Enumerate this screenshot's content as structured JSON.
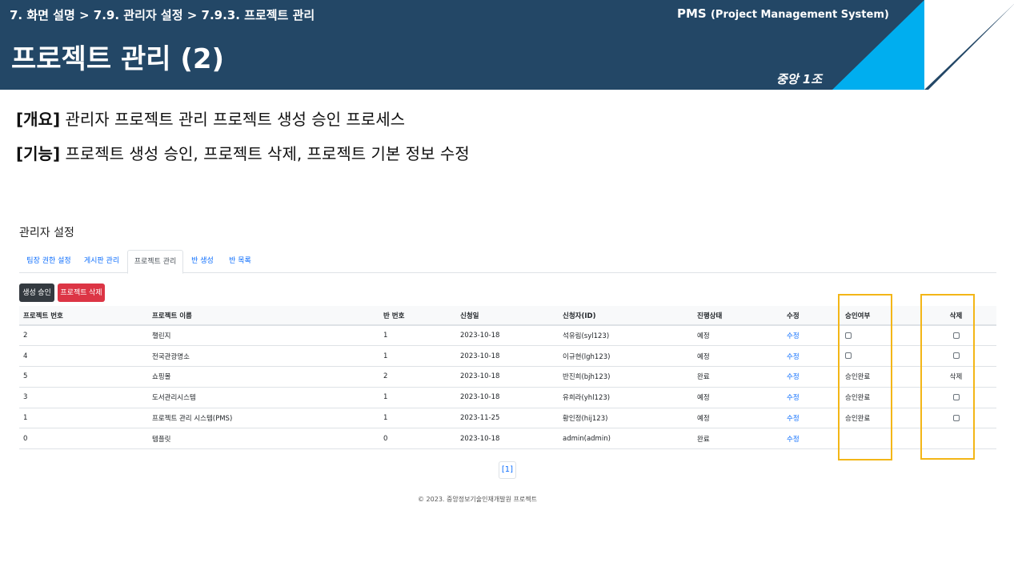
{
  "header": {
    "breadcrumb": "7. 화면 설명 > 7.9. 관리자 설정 > 7.9.3. 프로젝트 관리",
    "title": "프로젝트 관리 (2)",
    "system_name": "PMS",
    "system_full": "(Project Management System)",
    "team": "중앙 1조",
    "colors": {
      "navy": "#234766",
      "cyan": "#00aeef"
    }
  },
  "summary": {
    "overview_label": "[개요]",
    "overview_text": " 관리자 프로젝트 관리 프로젝트 생성 승인 프로세스",
    "feature_label": "[기능]",
    "feature_text": " 프로젝트 생성 승인, 프로젝트 삭제, 프로젝트 기본 정보 수정"
  },
  "app": {
    "title": "관리자 설정",
    "tabs": [
      "팀장 권한 설정",
      "게시판 관리",
      "프로젝트 관리",
      "반 생성",
      "반 목록"
    ],
    "active_tab": "프로젝트 관리",
    "buttons": {
      "approve": "생성 승인",
      "delete": "프로젝트 삭제"
    },
    "table": {
      "headers": [
        "프로젝트 번호",
        "프로젝트 이름",
        "반 번호",
        "신청일",
        "신청자(ID)",
        "진행상태",
        "수정",
        "승인여부",
        "삭제"
      ],
      "rows": [
        {
          "no": "2",
          "name": "챌린지",
          "class": "1",
          "date": "2023-10-18",
          "applicant": "석유림(syl123)",
          "status": "예정",
          "edit": "수정",
          "approval": "",
          "delete": ""
        },
        {
          "no": "4",
          "name": "전국관광명소",
          "class": "1",
          "date": "2023-10-18",
          "applicant": "이규현(lgh123)",
          "status": "예정",
          "edit": "수정",
          "approval": "",
          "delete": ""
        },
        {
          "no": "5",
          "name": "쇼핑몰",
          "class": "2",
          "date": "2023-10-18",
          "applicant": "반진희(bjh123)",
          "status": "완료",
          "edit": "수정",
          "approval": "승인완료",
          "delete": "삭제"
        },
        {
          "no": "3",
          "name": "도서관리시스템",
          "class": "1",
          "date": "2023-10-18",
          "applicant": "유희라(yhl123)",
          "status": "예정",
          "edit": "수정",
          "approval": "승인완료",
          "delete": ""
        },
        {
          "no": "1",
          "name": "프로젝트 관리 시스템(PMS)",
          "class": "1",
          "date": "2023-11-25",
          "applicant": "황인정(hij123)",
          "status": "예정",
          "edit": "수정",
          "approval": "승인완료",
          "delete": ""
        },
        {
          "no": "0",
          "name": "템플릿",
          "class": "0",
          "date": "2023-10-18",
          "applicant": "admin(admin)",
          "status": "완료",
          "edit": "수정",
          "approval": "",
          "delete": ""
        }
      ],
      "checkbox_cells": {
        "approval": [
          true,
          true,
          false,
          false,
          false,
          false
        ],
        "delete": [
          true,
          true,
          false,
          true,
          true,
          false
        ]
      }
    },
    "pager": "[1]",
    "footer": "© 2023. 중앙정보기술인재개발원 프로젝트"
  }
}
